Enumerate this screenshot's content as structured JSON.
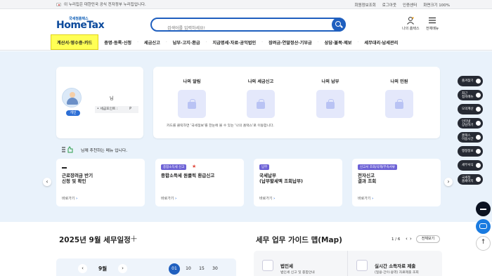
{
  "topbar": {
    "gov_notice": "이 누리집은 대한민국 공식 전자정부 누리집입니다.",
    "links": [
      "회원정보조회",
      "로그아웃",
      "인증센터",
      "화면크기 100%"
    ]
  },
  "header": {
    "logo_small": "국세청홈택스",
    "logo_big": "HomeTax",
    "search_placeholder": "검색어를 입력하세요!",
    "my_hometax_label": "나의 홈택스",
    "all_menu_label": "전체메뉴"
  },
  "nav": {
    "items": [
      "계산서·영수증·카드",
      "증명·등록·신청",
      "세금신고",
      "납부·고지·환급",
      "지급명세·자료·공익법인",
      "장려금·연말정산·기부금",
      "상담·불복·제보",
      "세무대리·납세관리"
    ]
  },
  "profile": {
    "suffix": "님",
    "user_type": "개인",
    "points_label": "• 세금포인트 :",
    "points_value": "P"
  },
  "my_boxes": {
    "columns": [
      "나의 알림",
      "나의 세금신고",
      "나의 납부",
      "나의 민원"
    ],
    "note": "카드를 클릭하면 '국세정보'를 한눈에 볼 수 있는 '나의 홈택스'로 이동합니다."
  },
  "recommend": {
    "title": "님께 추천하는 메뉴 입니다.",
    "go_label": "바로가기",
    "cards": [
      {
        "tag": "",
        "title": "근로장려금 반기\n신청 및 확인"
      },
      {
        "tag": "종합소득세 신고",
        "title": "종합소득세 원클릭 환급신고"
      },
      {
        "tag": "납부",
        "title": "국세납부\n(납부할세액 조회납부)"
      },
      {
        "tag": "신고서 조회/삭제/부속서류",
        "title": "전자신고\n결과 조회"
      }
    ]
  },
  "quick_menu": [
    "즐겨찾기",
    "최근\n접속메뉴",
    "모의계산",
    "인터넷\n상담하기",
    "홈택스\n이용시간",
    "맹정정보",
    "세무서식",
    "국세청\n홈페이지"
  ],
  "schedule": {
    "title": "2025년 9월 세무일정",
    "month": "9월",
    "days": [
      "01",
      "10",
      "15",
      "30"
    ]
  },
  "guide": {
    "title": "세무 업무 가이드 맵(Map)",
    "pager": "1 / 6",
    "all_label": "전체보기",
    "items": [
      {
        "title": "법인세",
        "sub": "법인세 신고 및 종합안내"
      },
      {
        "title": "실시간 소득자료 제출",
        "sub": "(일용·간이·용역) 자료제출 조회"
      }
    ]
  },
  "colors": {
    "brand": "#1f5fbf",
    "active_nav": "#ffff55",
    "quick_bg": "#262a33"
  }
}
